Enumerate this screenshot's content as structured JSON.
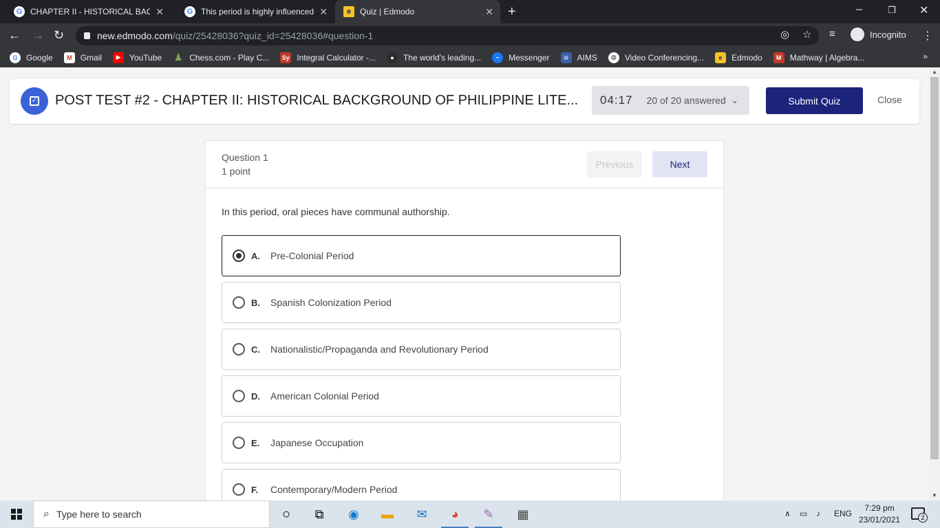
{
  "browser": {
    "tabs": [
      {
        "title": "CHAPTER II - HISTORICAL BACKG",
        "icon": "google-icon"
      },
      {
        "title": "This period is highly influenced b",
        "icon": "google-icon"
      },
      {
        "title": "Quiz | Edmodo",
        "icon": "edmodo-icon"
      }
    ],
    "url_host": "new.edmodo.com",
    "url_path": "/quiz/25428036?quiz_id=25428036#question-1",
    "profile_label": "Incognito",
    "bookmarks": [
      {
        "label": "Google",
        "color": "#ffffff"
      },
      {
        "label": "Gmail",
        "color": "#d93025"
      },
      {
        "label": "YouTube",
        "color": "#ff0000"
      },
      {
        "label": "Chess.com - Play C...",
        "color": "#7fa650"
      },
      {
        "label": "Integral Calculator -...",
        "color": "#c0392b"
      },
      {
        "label": "The world’s leading...",
        "color": "#2b2b2b"
      },
      {
        "label": "Messenger",
        "color": "#1877f2"
      },
      {
        "label": "AIMS",
        "color": "#3a5fa8"
      },
      {
        "label": "Video Conferencing...",
        "color": "#ffffff"
      },
      {
        "label": "Edmodo",
        "color": "#f7c325"
      },
      {
        "label": "Mathway | Algebra...",
        "color": "#c0392b"
      }
    ]
  },
  "quiz": {
    "title": "POST TEST #2 - CHAPTER II: HISTORICAL BACKGROUND OF PHILIPPINE LITE...",
    "timer": "04:17",
    "answered": "20 of 20 answered",
    "submit_label": "Submit Quiz",
    "close_label": "Close",
    "accent_color": "#1b237a"
  },
  "question": {
    "number_label": "Question 1",
    "points_label": "1 point",
    "previous_label": "Previous",
    "next_label": "Next",
    "prompt": "In this period, oral pieces have communal authorship.",
    "options": [
      {
        "letter": "A.",
        "text": "Pre-Colonial Period",
        "selected": true
      },
      {
        "letter": "B.",
        "text": "Spanish Colonization Period",
        "selected": false
      },
      {
        "letter": "C.",
        "text": "Nationalistic/Propaganda and Revolutionary Period",
        "selected": false
      },
      {
        "letter": "D.",
        "text": "American Colonial Period",
        "selected": false
      },
      {
        "letter": "E.",
        "text": "Japanese Occupation",
        "selected": false
      },
      {
        "letter": "F.",
        "text": "Contemporary/Modern Period",
        "selected": false
      }
    ]
  },
  "taskbar": {
    "search_placeholder": "Type here to search",
    "language": "ENG",
    "time": "7:29 pm",
    "date": "23/01/2021",
    "notification_count": "2"
  }
}
